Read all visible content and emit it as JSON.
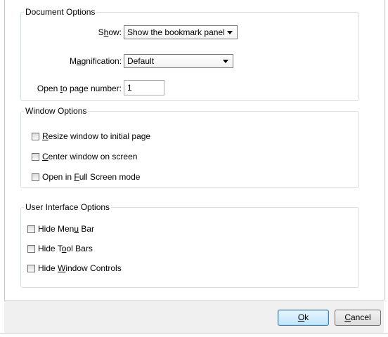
{
  "document_options": {
    "title": "Document Options",
    "show_label_pre": "S",
    "show_label_mn": "h",
    "show_label_post": "ow:",
    "show_value": "Show the bookmark panel",
    "magnification_label_pre": "M",
    "magnification_label_mn": "a",
    "magnification_label_post": "gnification:",
    "magnification_value": "Default",
    "page_label_pre": "Open ",
    "page_label_mn": "t",
    "page_label_post": "o page number:",
    "page_value": "1"
  },
  "window_options": {
    "title": "Window Options",
    "items": [
      {
        "pre": "",
        "mn": "R",
        "post": "esize window to initial page",
        "checked": false
      },
      {
        "pre": "",
        "mn": "C",
        "post": "enter window on screen",
        "checked": false
      },
      {
        "pre": "Open in ",
        "mn": "F",
        "post": "ull Screen mode",
        "checked": false
      }
    ]
  },
  "ui_options": {
    "title": "User Interface Options",
    "items": [
      {
        "pre": "Hide Men",
        "mn": "u",
        "post": " Bar",
        "checked": false
      },
      {
        "pre": "Hide T",
        "mn": "o",
        "post": "ol Bars",
        "checked": false
      },
      {
        "pre": "Hide ",
        "mn": "W",
        "post": "indow Controls",
        "checked": false
      }
    ]
  },
  "buttons": {
    "ok_mn": "O",
    "ok_post": "k",
    "cancel_mn": "C",
    "cancel_post": "ancel"
  }
}
